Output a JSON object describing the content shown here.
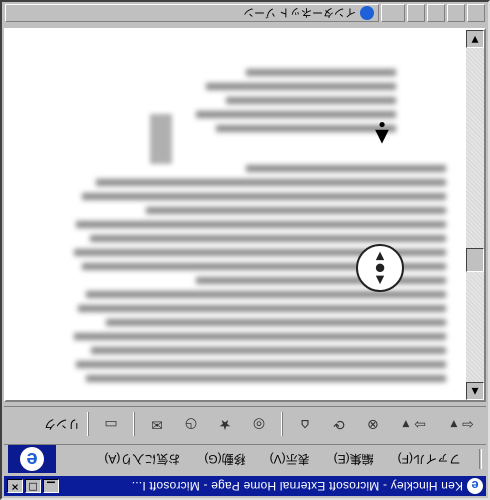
{
  "window": {
    "title": "Ken Hinckley - Microsoft External Home Page - Microsoft I...",
    "min_glyph": "▁",
    "max_glyph": "□",
    "close_glyph": "×"
  },
  "menu": {
    "items": [
      "ファイル(F)",
      "編集(E)",
      "表示(V)",
      "移動(G)",
      "お気に入り(A)"
    ]
  },
  "toolbar": {
    "back_glyph": "⇦ ▾",
    "forward_glyph": "⇨ ▾",
    "stop_glyph": "⊗",
    "refresh_glyph": "⟳",
    "home_glyph": "⌂",
    "search_glyph": "◎",
    "favorites_glyph": "★",
    "history_glyph": "◷",
    "mail_glyph": "✉",
    "print_glyph": "▭",
    "links_label": "リンク"
  },
  "statusbar": {
    "text": "インターネット ゾーン"
  },
  "scrollbar": {
    "up_glyph": "▲",
    "down_glyph": "▼"
  },
  "pan_widget": {
    "up_glyph": "▲",
    "center_glyph": "●",
    "down_glyph": "▼"
  },
  "cursor": {
    "arrow_glyph": "▲",
    "dot_glyph": "•"
  },
  "colors": {
    "titlebar": "#0a1c9a",
    "window": "#c0c0c0",
    "content": "#ffffff"
  },
  "icons": {
    "title": "ie-logo-icon",
    "menu_logo": "ie-logo-icon",
    "status": "ie-logo-icon"
  }
}
